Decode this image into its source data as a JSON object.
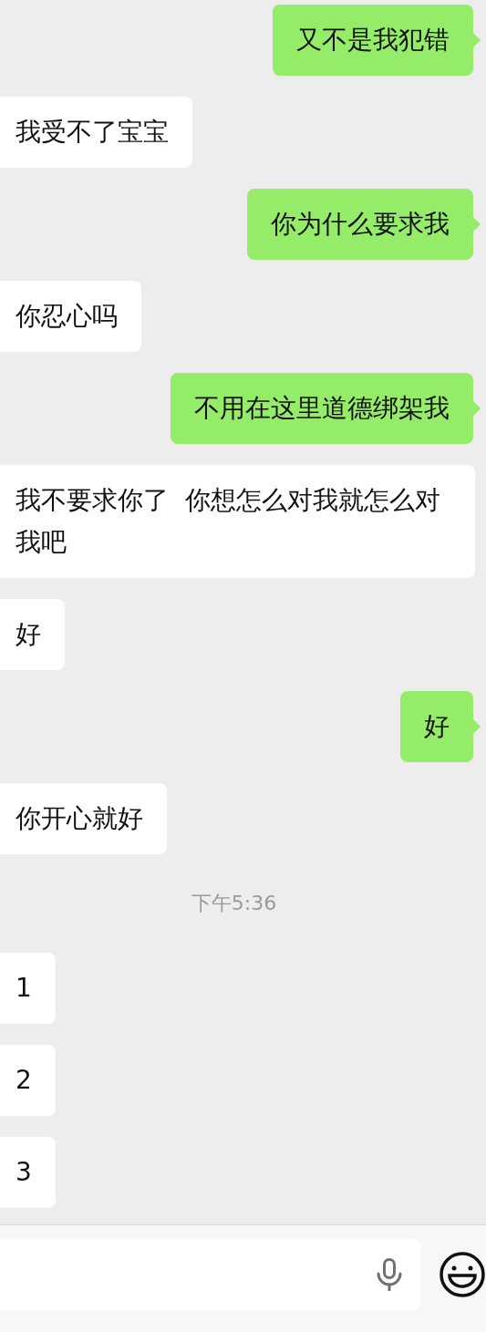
{
  "messages": [
    {
      "kind": "sent",
      "text": "又不是我犯错"
    },
    {
      "kind": "received",
      "text": "我受不了宝宝"
    },
    {
      "kind": "sent",
      "text": "你为什么要求我"
    },
    {
      "kind": "received",
      "text": "你忍心吗"
    },
    {
      "kind": "sent",
      "text": "不用在这里道德绑架我"
    },
    {
      "kind": "received",
      "text": "我不要求你了  你想怎么对我就怎么对我吧"
    },
    {
      "kind": "received",
      "text": "好"
    },
    {
      "kind": "sent",
      "text": "好"
    },
    {
      "kind": "received",
      "text": "你开心就好"
    },
    {
      "kind": "time",
      "text": "下午5:36"
    },
    {
      "kind": "received",
      "text": "1"
    },
    {
      "kind": "received",
      "text": "2"
    },
    {
      "kind": "received",
      "text": "3"
    }
  ]
}
